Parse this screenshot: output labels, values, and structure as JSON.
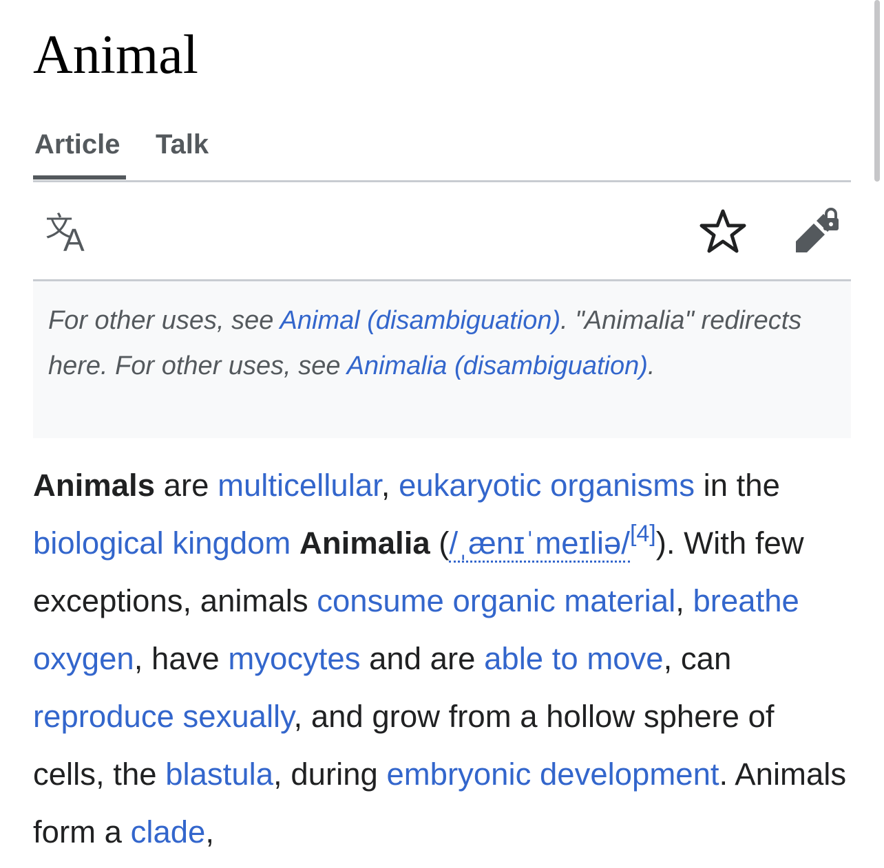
{
  "page": {
    "title": "Animal"
  },
  "tabs": [
    {
      "label": "Article",
      "selected": true
    },
    {
      "label": "Talk",
      "selected": false
    }
  ],
  "toolbar": {
    "language_icon": "translate-icon",
    "watch_icon": "star-icon",
    "edit_icon": "locked-edit-icon"
  },
  "hatnote": {
    "t1": "For other uses, see ",
    "l1": "Animal (disambiguation)",
    "t2": ". \"Animalia\" redirects here. For other uses, see ",
    "l2": "Animalia (disambiguation)",
    "t3": "."
  },
  "lead": {
    "b1": "Animals",
    "t1": " are ",
    "l1": "multicellular",
    "t2": ", ",
    "l2": "eukaryotic organisms",
    "t3": " in the ",
    "l3": "biological kingdom",
    "t4": " ",
    "b2": "Animalia",
    "t5": " (",
    "ipa": "/ˌænɪˈmeɪliə/",
    "ref": "[4]",
    "t6": "). With few exceptions, animals ",
    "l4": "consume organic material",
    "t7": ", ",
    "l5": "breathe oxygen",
    "t8": ", have ",
    "l6": "myocytes",
    "t9": " and are ",
    "l7": "able to move",
    "t10": ", can ",
    "l8": "reproduce sexually",
    "t11": ", and grow from a hollow sphere of cells, the ",
    "l9": "blastula",
    "t12": ", during ",
    "l10": "embryonic development",
    "t13": ". Animals form a ",
    "l11": "clade",
    "t14": ","
  },
  "colors": {
    "link": "#3366cc",
    "text": "#202122",
    "muted": "#54595d",
    "hatnote_bg": "#f8f9fa",
    "border": "#c8ccd1"
  }
}
